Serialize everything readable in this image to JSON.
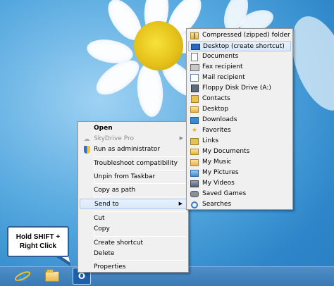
{
  "callout": {
    "line1": "Hold SHIFT +",
    "line2": "Right Click"
  },
  "context_menu": {
    "items": [
      {
        "label": "Open",
        "underline": "O",
        "rest": "pen",
        "bold": true
      },
      {
        "label": "SkyDrive Pro",
        "disabled": true,
        "icon": "cloud-icon"
      },
      {
        "label": "Run as administrator",
        "icon": "uac-shield-icon"
      },
      {
        "label": "Troubleshoot compatibility"
      },
      {
        "label": "Unpin from Taskbar"
      },
      {
        "label": "Copy as path"
      },
      {
        "label": "Send to",
        "has_submenu": true,
        "highlighted": true
      },
      {
        "label": "Cut"
      },
      {
        "label": "Copy"
      },
      {
        "label": "Create shortcut"
      },
      {
        "label": "Delete"
      },
      {
        "label": "Properties"
      }
    ]
  },
  "send_to_menu": {
    "items": [
      {
        "label": "Compressed (zipped) folder",
        "icon": "zip-folder-icon"
      },
      {
        "label": "Desktop (create shortcut)",
        "icon": "desktop-icon",
        "highlighted": true
      },
      {
        "label": "Documents",
        "icon": "documents-icon"
      },
      {
        "label": "Fax recipient",
        "icon": "fax-icon"
      },
      {
        "label": "Mail recipient",
        "icon": "mail-icon"
      },
      {
        "label": "Floppy Disk Drive (A:)",
        "icon": "floppy-disk-icon"
      },
      {
        "label": "Contacts",
        "icon": "contacts-icon"
      },
      {
        "label": "Desktop",
        "icon": "desktop-folder-icon"
      },
      {
        "label": "Downloads",
        "icon": "downloads-icon"
      },
      {
        "label": "Favorites",
        "icon": "favorites-icon"
      },
      {
        "label": "Links",
        "icon": "links-icon"
      },
      {
        "label": "My Documents",
        "icon": "my-documents-icon"
      },
      {
        "label": "My Music",
        "icon": "my-music-icon"
      },
      {
        "label": "My Pictures",
        "icon": "my-pictures-icon"
      },
      {
        "label": "My Videos",
        "icon": "my-videos-icon"
      },
      {
        "label": "Saved Games",
        "icon": "saved-games-icon"
      },
      {
        "label": "Searches",
        "icon": "searches-icon"
      }
    ]
  },
  "taskbar": {
    "ie_glyph": "e",
    "outlook_glyph": "O"
  }
}
